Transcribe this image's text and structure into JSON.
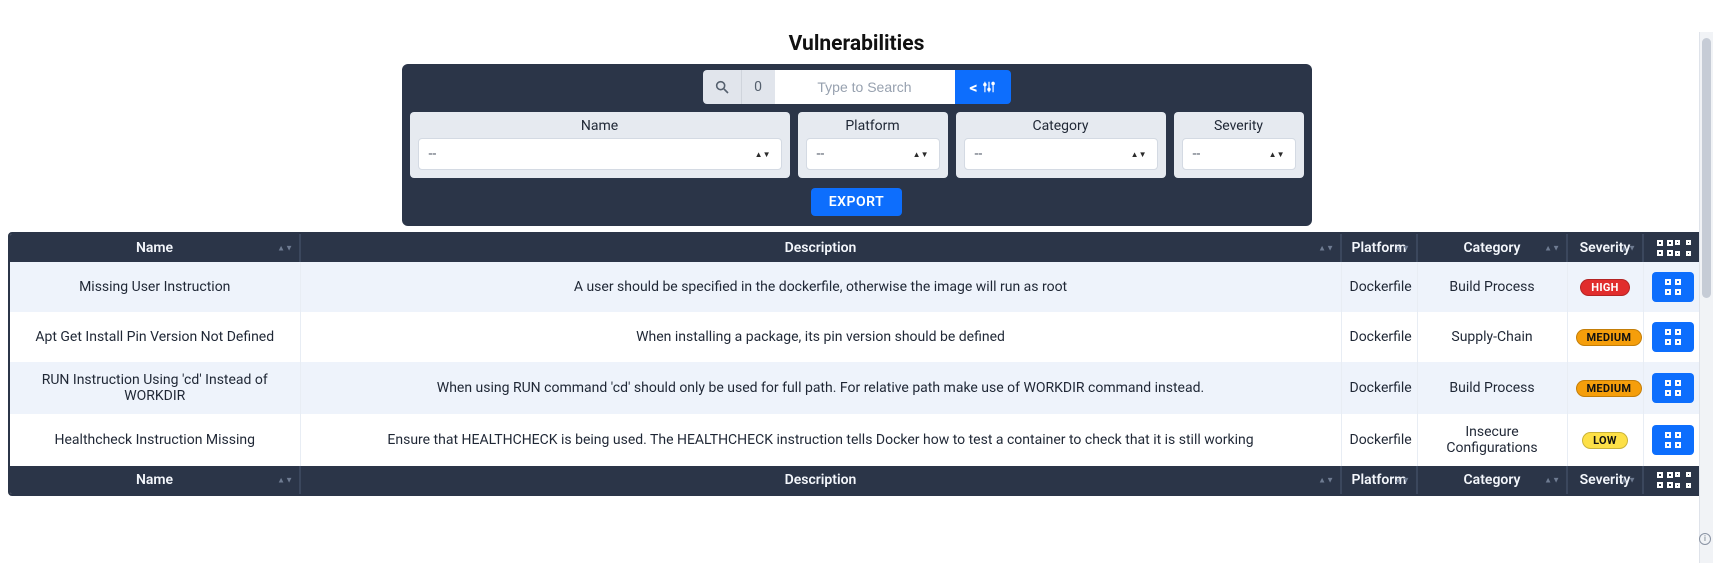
{
  "title": "Vulnerabilities",
  "search": {
    "count": "0",
    "placeholder": "Type to Search",
    "adv_label": "<"
  },
  "filters": {
    "name": {
      "label": "Name",
      "value": "--"
    },
    "platform": {
      "label": "Platform",
      "value": "--"
    },
    "category": {
      "label": "Category",
      "value": "--"
    },
    "severity": {
      "label": "Severity",
      "value": "--"
    }
  },
  "export_label": "EXPORT",
  "columns": {
    "name": "Name",
    "description": "Description",
    "platform": "Platform",
    "category": "Category",
    "severity": "Severity"
  },
  "rows": [
    {
      "name": "Missing User Instruction",
      "description": "A user should be specified in the dockerfile, otherwise the image will run as root",
      "platform": "Dockerfile",
      "category": "Build Process",
      "severity": "HIGH"
    },
    {
      "name": "Apt Get Install Pin Version Not Defined",
      "description": "When installing a package, its pin version should be defined",
      "platform": "Dockerfile",
      "category": "Supply-Chain",
      "severity": "MEDIUM"
    },
    {
      "name": "RUN Instruction Using 'cd' Instead of WORKDIR",
      "description": "When using RUN command 'cd' should only be used for full path. For relative path make use of WORKDIR command instead.",
      "platform": "Dockerfile",
      "category": "Build Process",
      "severity": "MEDIUM"
    },
    {
      "name": "Healthcheck Instruction Missing",
      "description": "Ensure that HEALTHCHECK is being used. The HEALTHCHECK instruction tells Docker how to test a container to check that it is still working",
      "platform": "Dockerfile",
      "category": "Insecure Configurations",
      "severity": "LOW"
    }
  ]
}
